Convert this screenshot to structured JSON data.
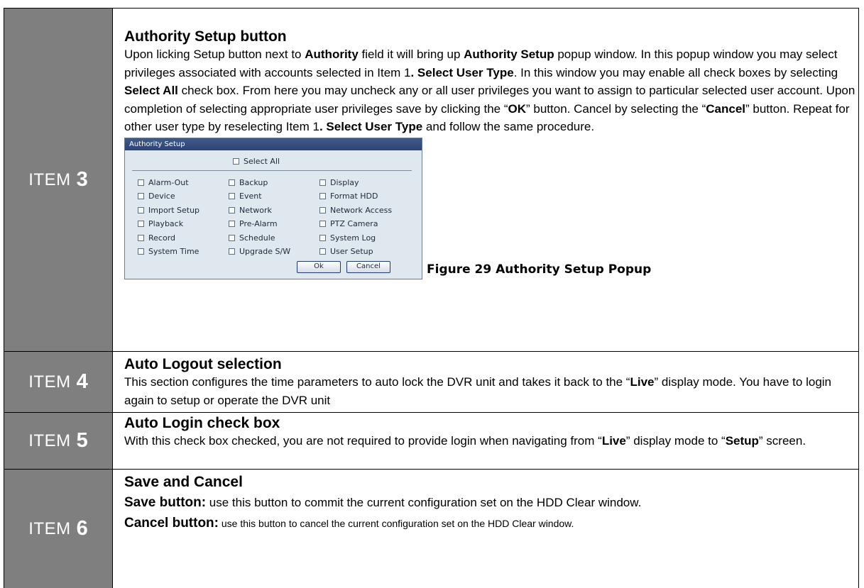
{
  "rows": [
    {
      "item_word": "ITEM",
      "item_num": "3",
      "heading": "Authority Setup button",
      "para_parts": [
        "Upon licking Setup button next to ",
        "Authority",
        " field it will bring up ",
        "Authority Setup",
        " popup window. In this popup window you may select privileges associated with accounts selected in Item 1",
        ". Select User Type",
        ". In this window you may enable all check boxes by selecting ",
        "Select All",
        " check box. From here you may uncheck any or all user privileges you want to assign to particular selected user account. Upon completion of selecting appropriate user privileges save by clicking the “",
        "OK",
        "” button. Cancel by selecting the “",
        "Cancel",
        "” button.  Repeat for other user type by reselecting Item 1",
        ". Select User Type",
        " and follow the same procedure."
      ],
      "figure_caption": "Figure 29 Authority Setup Popup"
    },
    {
      "item_word": "ITEM",
      "item_num": "4",
      "heading": "Auto Logout selection",
      "para_parts": [
        "This section configures the time parameters to auto lock the DVR unit and takes it back to the “",
        "Live",
        "” display mode.  You have to login again to setup or operate the DVR unit"
      ]
    },
    {
      "item_word": "ITEM",
      "item_num": "5",
      "heading": "Auto Login check box",
      "para_parts": [
        "With this check box checked, you are not required to provide login when navigating from “",
        "Live",
        "” display mode to “",
        "Setup",
        "” screen."
      ]
    },
    {
      "item_word": "ITEM",
      "item_num": "6",
      "heading": "Save and Cancel",
      "line1_bold": "Save button:",
      "line1_text": " use this button to commit the current configuration set on the HDD Clear window.",
      "line2_bold": "Cancel button:",
      "line2_text": " use this button to cancel the current configuration set on the HDD Clear window."
    }
  ],
  "popup": {
    "title": "Authority Setup",
    "select_all": "Select All",
    "options": [
      [
        "Alarm-Out",
        "Backup",
        "Display"
      ],
      [
        "Device",
        "Event",
        "Format HDD"
      ],
      [
        "Import Setup",
        "Network",
        "Network Access"
      ],
      [
        "Playback",
        "Pre-Alarm",
        "PTZ Camera"
      ],
      [
        "Record",
        "Schedule",
        "System Log"
      ],
      [
        "System Time",
        "Upgrade S/W",
        "User Setup"
      ]
    ],
    "ok_label": "Ok",
    "cancel_label": "Cancel"
  }
}
